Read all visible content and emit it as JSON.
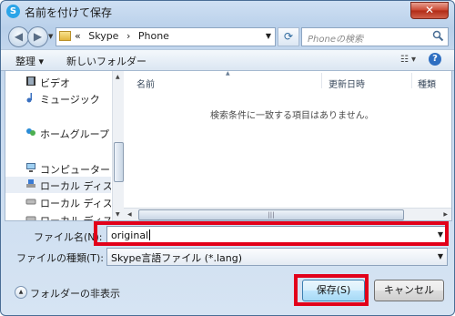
{
  "window": {
    "title": "名前を付けて保存",
    "app_icon": "S",
    "close_glyph": "✕"
  },
  "address_bar": {
    "prefix": "«",
    "path": [
      "Skype",
      "Phone"
    ],
    "path_sep": "›",
    "search_placeholder": "Phoneの検索"
  },
  "toolbar": {
    "organize_label": "整理 ▾",
    "new_folder_label": "新しいフォルダー",
    "help_glyph": "?"
  },
  "nav_pane": {
    "items": [
      {
        "label": "ビデオ",
        "icon": "video-icon"
      },
      {
        "label": "ミュージック",
        "icon": "music-icon"
      },
      {
        "label": "ホームグループ",
        "icon": "homegroup-icon"
      },
      {
        "label": "コンピューター",
        "icon": "computer-icon"
      },
      {
        "label": "ローカル ディス",
        "icon": "drive-icon"
      },
      {
        "label": "ローカル ディス",
        "icon": "drive-icon"
      },
      {
        "label": "ローカル ディス",
        "icon": "drive-icon"
      }
    ]
  },
  "file_list": {
    "columns": [
      "名前",
      "更新日時",
      "種類"
    ],
    "empty_message": "検索条件に一致する項目はありません。"
  },
  "form": {
    "filename_label": "ファイル名(N):",
    "filename_value": "original",
    "filetype_label": "ファイルの種類(T):",
    "filetype_value": "Skype言語ファイル (*.lang)"
  },
  "footer": {
    "hide_folders_label": "フォルダーの非表示",
    "save_label": "保存(S)",
    "cancel_label": "キャンセル"
  },
  "colors": {
    "highlight": "#e2001a",
    "accent": "#2f6fc1"
  }
}
